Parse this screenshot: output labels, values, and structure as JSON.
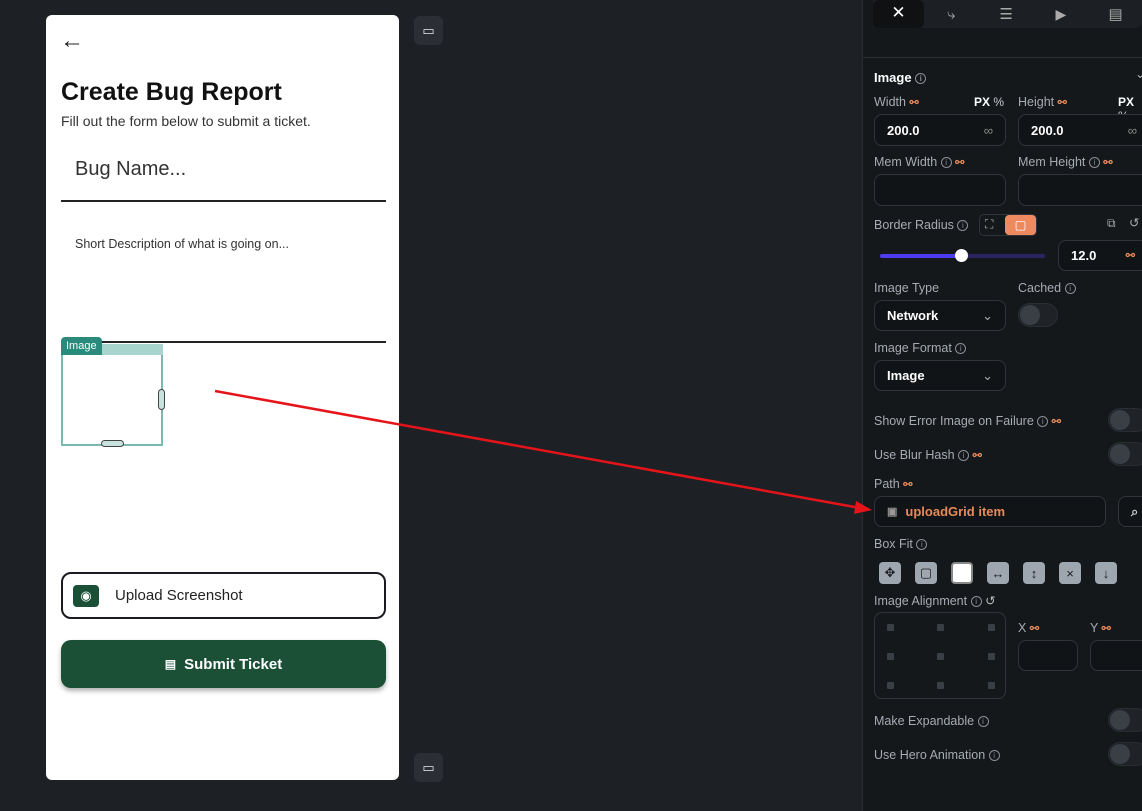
{
  "phone": {
    "back_icon": "arrow-left-icon",
    "title": "Create Bug Report",
    "subtitle": "Fill out the form below to submit a ticket.",
    "bug_name_placeholder": "Bug Name...",
    "description_placeholder": "Short Description of what is going on...",
    "image_widget_tag": "Image",
    "upload_label": "Upload Screenshot",
    "submit_label": "Submit Ticket"
  },
  "panel": {
    "tabs": [
      "properties",
      "actions",
      "backend-query",
      "run",
      "add-to-page"
    ],
    "section_title": "Image",
    "width_label": "Width",
    "height_label": "Height",
    "unit_px": "PX",
    "unit_pct": "%",
    "width_value": "200.0",
    "height_value": "200.0",
    "infinity": "∞",
    "mem_width_label": "Mem Width",
    "mem_height_label": "Mem Height",
    "border_radius_label": "Border Radius",
    "border_radius_value": "12.0",
    "border_radius_slider_fraction": 0.49,
    "image_type_label": "Image Type",
    "image_type_value": "Network",
    "cached_label": "Cached",
    "cached_on": false,
    "image_format_label": "Image Format",
    "image_format_value": "Image",
    "show_error_label": "Show Error Image on Failure",
    "blur_hash_label": "Use Blur Hash",
    "path_label": "Path",
    "path_value": "uploadGrid item",
    "box_fit_label": "Box Fit",
    "box_fit_selected": "fill",
    "alignment_label": "Image Alignment",
    "x_label": "X",
    "y_label": "Y",
    "expandable_label": "Make Expandable",
    "hero_label": "Use Hero Animation"
  },
  "colors": {
    "accent": "#e88a5a",
    "brand_green": "#1b5036",
    "slider": "#4f3bf0",
    "arrow": "#e5141a"
  }
}
